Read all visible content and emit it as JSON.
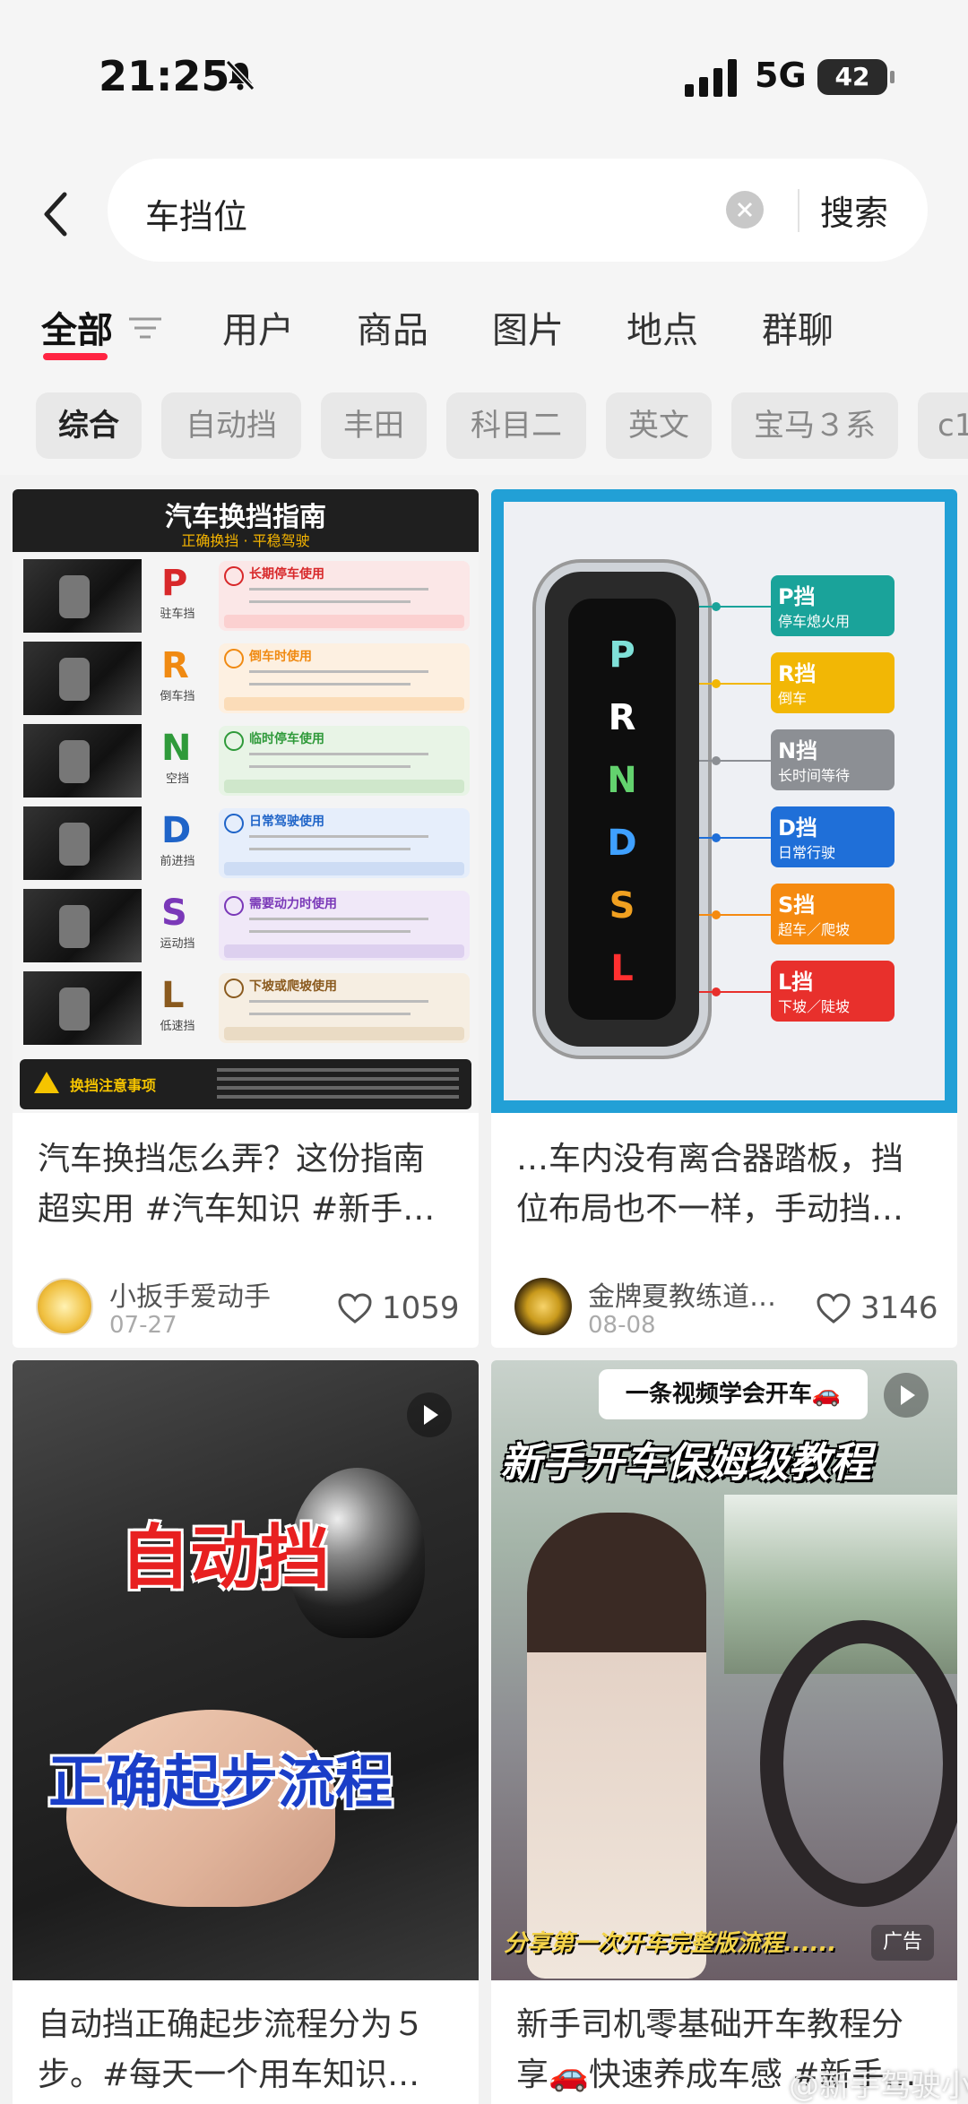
{
  "status_bar": {
    "time": "21:25",
    "network": "5G",
    "battery": "42"
  },
  "search": {
    "query": "车挡位",
    "button": "搜索"
  },
  "tabs": [
    "全部",
    "用户",
    "商品",
    "图片",
    "地点",
    "群聊"
  ],
  "chips": [
    "综合",
    "自动挡",
    "丰田",
    "科目二",
    "英文",
    "宝马３系",
    "c1"
  ],
  "cards": [
    {
      "title_line1": "汽车换挡怎么弄？这份指南",
      "title_line2": "超实用 #汽车知识 #新手…",
      "author": "小扳手爱动手",
      "date": "07-27",
      "likes": "1059"
    },
    {
      "title_line1": "…车内没有离合器踏板，挡",
      "title_line2": "位布局也不一样，手动挡…",
      "author": "金牌夏教练道…",
      "date": "08-08",
      "likes": "3146"
    },
    {
      "title_line1": "自动挡正确起步流程分为５",
      "title_line2": "步。#每天一个用车知识…"
    },
    {
      "title_line1": "新手司机零基础开车教程分",
      "title_line2": "享🚗快速养成车感 #新手…"
    }
  ],
  "guide": {
    "title": "汽车换挡指南",
    "subtitle": "正确换挡 · 平稳驾驶",
    "rows": [
      {
        "letter": "P",
        "name": "驻车挡",
        "heading": "长期停车使用",
        "color": "#d8282a",
        "bg": "#fbe7e7",
        "note": "#fbd0d0"
      },
      {
        "letter": "R",
        "name": "倒车挡",
        "heading": "倒车时使用",
        "color": "#f08a12",
        "bg": "#fdf0e1",
        "note": "#fbdcb8"
      },
      {
        "letter": "N",
        "name": "空挡",
        "heading": "临时停车使用",
        "color": "#2f9a3a",
        "bg": "#e8f4e6",
        "note": "#cfe7cb"
      },
      {
        "letter": "D",
        "name": "前进挡",
        "heading": "日常驾驶使用",
        "color": "#1f64c8",
        "bg": "#e6eefb",
        "note": "#cddcf4"
      },
      {
        "letter": "S",
        "name": "运动挡",
        "heading": "需要动力时使用",
        "color": "#7a38b8",
        "bg": "#f0e8f8",
        "note": "#ddd0ef"
      },
      {
        "letter": "L",
        "name": "低速挡",
        "heading": "下坡或爬坡使用",
        "color": "#8a5a1e",
        "bg": "#f6eee2",
        "note": "#eadbc4"
      }
    ],
    "footer": "换挡注意事项"
  },
  "panel": {
    "letters": [
      {
        "letter": "P",
        "color": "#7fe0d8"
      },
      {
        "letter": "R",
        "color": "#ffffff"
      },
      {
        "letter": "N",
        "color": "#63d26e"
      },
      {
        "letter": "D",
        "color": "#3fa0ff"
      },
      {
        "letter": "S",
        "color": "#f0a020"
      },
      {
        "letter": "L",
        "color": "#ff3030"
      }
    ],
    "labels": [
      {
        "title": "P挡",
        "desc": "停车熄火用",
        "color": "#1aa39a"
      },
      {
        "title": "R挡",
        "desc": "倒车",
        "color": "#f2b705"
      },
      {
        "title": "N挡",
        "desc": "长时间等待",
        "color": "#8c8f94"
      },
      {
        "title": "D挡",
        "desc": "日常行驶",
        "color": "#1f6fd8"
      },
      {
        "title": "S挡",
        "desc": "超车／爬坡",
        "color": "#f58a10"
      },
      {
        "title": "L挡",
        "desc": "下坡／陡坡",
        "color": "#e8302c"
      }
    ]
  },
  "video1": {
    "line1": "自动挡",
    "line2": "正确起步流程"
  },
  "video2": {
    "banner": "一条视频学会开车🚗",
    "headline": "新手开车保姆级教程",
    "caption": "分享第一次开车完整版流程......",
    "ad_tag": "广告"
  },
  "watermark": "@新手驾驶小美"
}
